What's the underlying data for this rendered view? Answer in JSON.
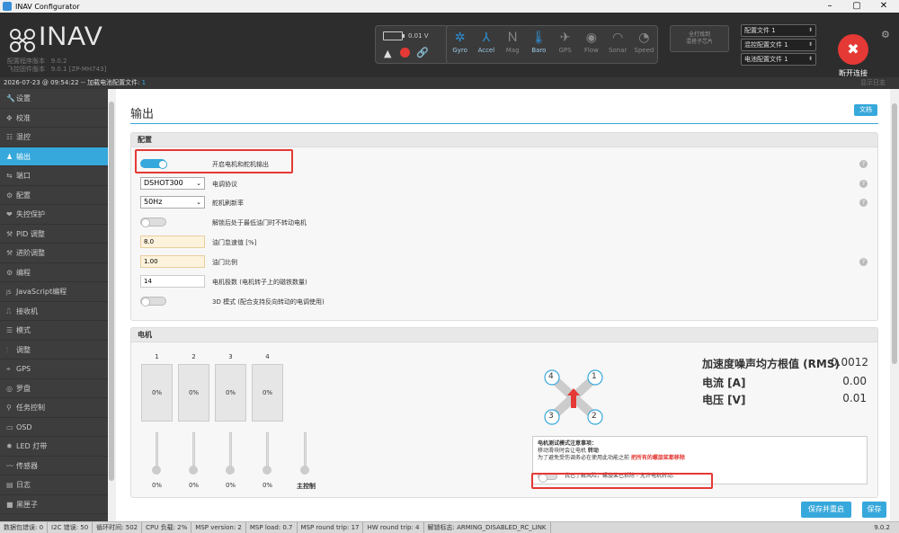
{
  "window": {
    "title": "INAV Configurator",
    "min": "–",
    "max": "▢",
    "close": "✕"
  },
  "header": {
    "logo": "INAV",
    "config_version_label": "配置程序版本",
    "config_version": "9.0.2",
    "fw_version_label": "飞控固件版本",
    "fw_version": "9.0.1 [ZP-MH743]",
    "battery_voltage": "0.01 V",
    "sensors": [
      {
        "label": "Gyro",
        "icon": "gyro-icon",
        "glyph": "✲",
        "active": true
      },
      {
        "label": "Accel",
        "icon": "accel-icon",
        "glyph": "⅄",
        "active": true
      },
      {
        "label": "Mag",
        "icon": "mag-icon",
        "glyph": "Ｎ",
        "active": false
      },
      {
        "label": "Baro",
        "icon": "baro-icon",
        "glyph": "🌡",
        "active": true
      },
      {
        "label": "GPS",
        "icon": "gps-icon",
        "glyph": "✈",
        "active": false
      },
      {
        "label": "Flow",
        "icon": "flow-icon",
        "glyph": "◉",
        "active": false
      },
      {
        "label": "Sonar",
        "icon": "sonar-icon",
        "glyph": "◠",
        "active": false
      },
      {
        "label": "Speed",
        "icon": "speed-icon",
        "glyph": "◔",
        "active": false
      }
    ],
    "tiny_box_line1": "全打找到",
    "tiny_box_line2": "混搭子芯片",
    "profiles": [
      "配置文件 1",
      "混控配置文件 1",
      "电池配置文件 1"
    ],
    "disconnect_label": "断开连接"
  },
  "status": {
    "prefix": "2026-07-23 @ 09:54:22 -- 加载电池配置文件:",
    "value": "1",
    "log_toggle": "显示日志"
  },
  "sidebar": {
    "items": [
      {
        "label": "设置",
        "icon": "wrench-icon",
        "glyph": "🔧"
      },
      {
        "label": "校准",
        "icon": "crosshair-icon",
        "glyph": "✥"
      },
      {
        "label": "混控",
        "icon": "mixer-icon",
        "glyph": "☷"
      },
      {
        "label": "输出",
        "icon": "output-icon",
        "glyph": "♟",
        "active": true
      },
      {
        "label": "端口",
        "icon": "plug-icon",
        "glyph": "⇆"
      },
      {
        "label": "配置",
        "icon": "gear-icon",
        "glyph": "⚙"
      },
      {
        "label": "失控保护",
        "icon": "shield-icon",
        "glyph": "❤"
      },
      {
        "label": "PID 调整",
        "icon": "pid-icon",
        "glyph": "⚒"
      },
      {
        "label": "进阶调整",
        "icon": "advanced-tuning-icon",
        "glyph": "⚒"
      },
      {
        "label": "编程",
        "icon": "programming-icon",
        "glyph": "⚙"
      },
      {
        "label": "JavaScript编程",
        "icon": "javascript-icon",
        "glyph": "JS"
      },
      {
        "label": "接收机",
        "icon": "receiver-icon",
        "glyph": "⎍"
      },
      {
        "label": "模式",
        "icon": "modes-icon",
        "glyph": "☰"
      },
      {
        "label": "调整",
        "icon": "adjustments-icon",
        "glyph": "⫶"
      },
      {
        "label": "GPS",
        "icon": "gps-icon",
        "glyph": "⌖"
      },
      {
        "label": "罗盘",
        "icon": "compass-icon",
        "glyph": "◎"
      },
      {
        "label": "任务控制",
        "icon": "mission-icon",
        "glyph": "⚲"
      },
      {
        "label": "OSD",
        "icon": "osd-icon",
        "glyph": "▭"
      },
      {
        "label": "LED 灯带",
        "icon": "led-icon",
        "glyph": "✹"
      },
      {
        "label": "传感器",
        "icon": "sensors-icon",
        "glyph": "〰"
      },
      {
        "label": "日志",
        "icon": "log-icon",
        "glyph": "▤"
      },
      {
        "label": "黑匣子",
        "icon": "blackbox-icon",
        "glyph": "■"
      }
    ]
  },
  "main": {
    "title": "输出",
    "docs": "文档",
    "config": {
      "header": "配置",
      "enable_motor_label": "开启电机和舵机输出",
      "esc_protocol": {
        "value": "DSHOT300",
        "label": "电调协议"
      },
      "servo_refresh": {
        "value": "50Hz",
        "label": "舵机刷新率"
      },
      "motor_stop_label": "解锁后处于最低油门时不转动电机",
      "throttle_idle": {
        "value": "8.0",
        "label": "油门怠速值 [%]"
      },
      "throttle_scale": {
        "value": "1.00",
        "label": "油门比例"
      },
      "motor_poles": {
        "value": "14",
        "label": "电机极数 (电机转子上的磁铁数量)"
      },
      "mode_3d_label": "3D 模式 (配合支持反向转动的电调使用)"
    },
    "motors": {
      "header": "电机",
      "items": [
        {
          "num": "1",
          "bar": "0%",
          "pct": "0%"
        },
        {
          "num": "2",
          "bar": "0%",
          "pct": "0%"
        },
        {
          "num": "3",
          "bar": "0%",
          "pct": "0%"
        },
        {
          "num": "4",
          "bar": "0%",
          "pct": "0%"
        }
      ],
      "master_label": "主控制",
      "noise_label": "加速度噪声均方根值 (RMS)",
      "noise_value": "0.0012",
      "current_label": "电流 [A]",
      "current_value": "0.00",
      "voltage_label": "电压 [V]",
      "voltage_value": "0.01",
      "quad_numbers": [
        "4",
        "1",
        "3",
        "2"
      ],
      "notice_title": "电机测试模式注意事项：",
      "notice_line1_a": "移动滑块时会让电机 ",
      "notice_line1_b": "转动",
      "notice_line2_a": "为了避免受伤调务必在使用此功能之前 ",
      "notice_line2_b": "把所有的螺旋桨都移除",
      "accept_label": "我已了解风险，螺旋桨已拆除 - 允许电机转动."
    },
    "save_reboot": "保存并重启",
    "save": "保存"
  },
  "footer": {
    "items": [
      "数据包错误: 0",
      "I2C 错误: 50",
      "循环时间: 502",
      "CPU 负载: 2%",
      "MSP version: 2",
      "MSP load: 0.7",
      "MSP round trip: 17",
      "HW round trip: 4",
      "解锁标志: ARMING_DISABLED_RC_LINK"
    ],
    "version": "9.0.2"
  }
}
